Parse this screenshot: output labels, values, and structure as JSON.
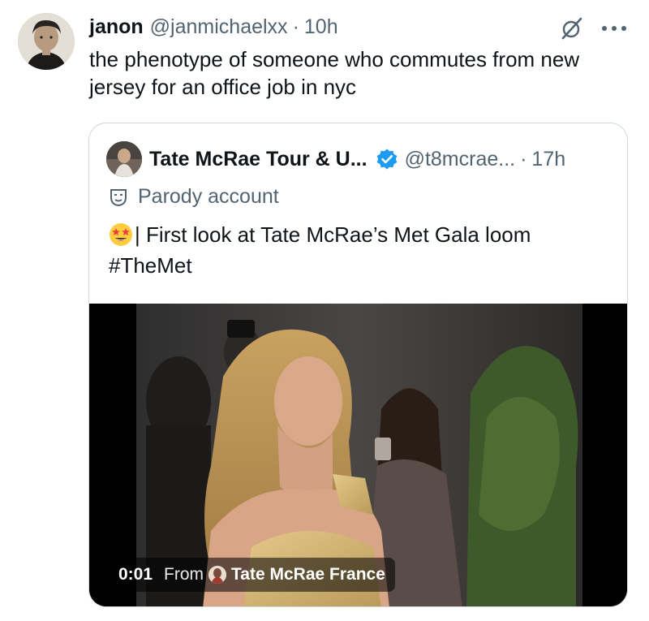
{
  "tweet": {
    "author_name": "janon",
    "handle": "@janmichaelxx",
    "separator": "·",
    "time": "10h",
    "text": "the phenotype of someone who commutes from new jersey for an office job in nyc"
  },
  "quote": {
    "author_name": "Tate McRae Tour & U...",
    "handle": "@t8mcrae...",
    "separator": "·",
    "time": "17h",
    "parody_label": "Parody account",
    "text_after_emoji": "| First look at Tate McRae’s Met Gala loom",
    "hashtag": "#TheMet",
    "emoji_icon": "star-struck-emoji-icon",
    "verified_color": "#1d9bf0"
  },
  "media": {
    "timestamp": "0:01",
    "from_label": "From",
    "source_name": "Tate McRae France"
  },
  "colors": {
    "text_primary": "#0f1419",
    "text_secondary": "#536471",
    "border": "#cfd9de",
    "accent": "#1d9bf0"
  }
}
